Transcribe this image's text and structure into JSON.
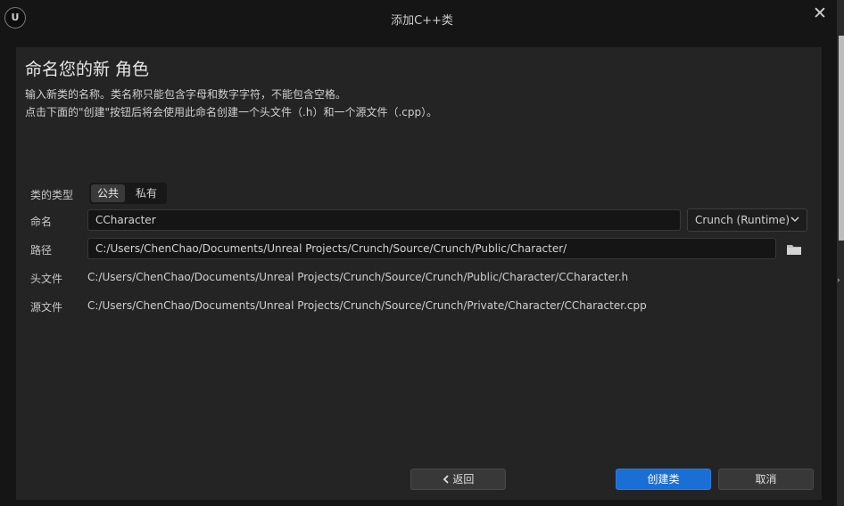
{
  "window": {
    "logo_text": "U",
    "title": "添加C++类",
    "close_glyph": "✕"
  },
  "dialog": {
    "heading": "命名您的新 角色",
    "desc_line1": "输入新类的名称。类名称只能包含字母和数字字符，不能包含空格。",
    "desc_line2": "点击下面的\"创建\"按钮后将会使用此命名创建一个头文件（.h）和一个源文件（.cpp）。"
  },
  "form": {
    "class_type_label": "类的类型",
    "class_type_options": [
      "公共",
      "私有"
    ],
    "class_type_selected": "公共",
    "name_label": "命名",
    "name_value": "CCharacter",
    "module_selected": "Crunch (Runtime)",
    "path_label": "路径",
    "path_value": "C:/Users/ChenChao/Documents/Unreal Projects/Crunch/Source/Crunch/Public/Character/",
    "header_label": "头文件",
    "header_value": "C:/Users/ChenChao/Documents/Unreal Projects/Crunch/Source/Crunch/Public/Character/CCharacter.h",
    "source_label": "源文件",
    "source_value": "C:/Users/ChenChao/Documents/Unreal Projects/Crunch/Source/Crunch/Private/Character/CCharacter.cpp"
  },
  "buttons": {
    "back": "返回",
    "create": "创建类",
    "cancel": "取消"
  },
  "icons": {
    "logo": "unreal-logo-icon",
    "close": "close-icon",
    "folder": "folder-icon",
    "dropdown": "chevron-down-icon",
    "back": "chevron-left-icon"
  },
  "colors": {
    "background": "#151515",
    "panel": "#242424",
    "primary_button": "#1a6fd6"
  }
}
